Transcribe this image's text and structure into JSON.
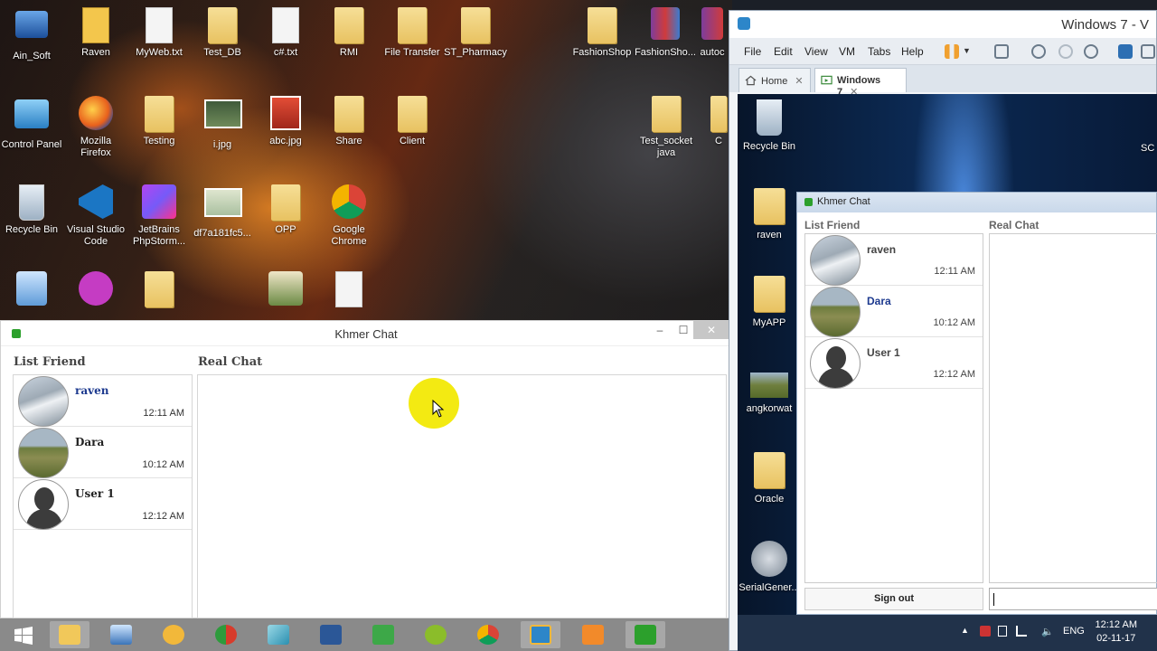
{
  "desktop": {
    "icons": [
      {
        "label": "Ain_Soft"
      },
      {
        "label": "Raven"
      },
      {
        "label": "MyWeb.txt"
      },
      {
        "label": "Test_DB"
      },
      {
        "label": "c#.txt"
      },
      {
        "label": "RMI"
      },
      {
        "label": "File Transfer"
      },
      {
        "label": "ST_Pharmacy"
      },
      {
        "label": "FashionShop"
      },
      {
        "label": "FashionSho..."
      },
      {
        "label": "autoc"
      },
      {
        "label": "Control Panel"
      },
      {
        "label": "Mozilla Firefox"
      },
      {
        "label": "Testing"
      },
      {
        "label": "i.jpg"
      },
      {
        "label": "abc.jpg"
      },
      {
        "label": "Share"
      },
      {
        "label": "Client"
      },
      {
        "label": "Test_socket java"
      },
      {
        "label": "C"
      },
      {
        "label": "Recycle Bin"
      },
      {
        "label": "Visual Studio Code"
      },
      {
        "label": "JetBrains PhpStorm..."
      },
      {
        "label": "df7a181fc5..."
      },
      {
        "label": "OPP"
      },
      {
        "label": "Google Chrome"
      }
    ]
  },
  "host_chat": {
    "title": "Khmer Chat",
    "list_label": "List Friend",
    "chat_label": "Real Chat",
    "friends": [
      {
        "name": "raven",
        "time": "12:11 AM"
      },
      {
        "name": "Dara",
        "time": "10:12 AM"
      },
      {
        "name": "User 1",
        "time": "12:12 AM"
      }
    ],
    "minimize": "–",
    "maximize": "☐",
    "close": "✕"
  },
  "vmware": {
    "title": "Windows 7 - V",
    "menu": [
      "File",
      "Edit",
      "View",
      "VM",
      "Tabs",
      "Help"
    ],
    "tabs": [
      {
        "label": "Home"
      },
      {
        "label": "Windows 7"
      }
    ],
    "tab_close": "✕"
  },
  "guest": {
    "icons": [
      {
        "label": "Recycle Bin"
      },
      {
        "label": "raven"
      },
      {
        "label": "MyAPP"
      },
      {
        "label": "angkorwat"
      },
      {
        "label": "Oracle"
      },
      {
        "label": "SerialGener..."
      },
      {
        "label": "SC"
      }
    ],
    "chat": {
      "title": "Khmer Chat",
      "list_label": "List Friend",
      "chat_label": "Real Chat",
      "friends": [
        {
          "name": "raven",
          "time": "12:11 AM"
        },
        {
          "name": "Dara",
          "time": "10:12 AM"
        },
        {
          "name": "User 1",
          "time": "12:12 AM"
        }
      ],
      "sign_out": "Sign out"
    },
    "tray": {
      "lang": "ENG",
      "time": "12:12 AM",
      "date": "02-11-17"
    }
  }
}
